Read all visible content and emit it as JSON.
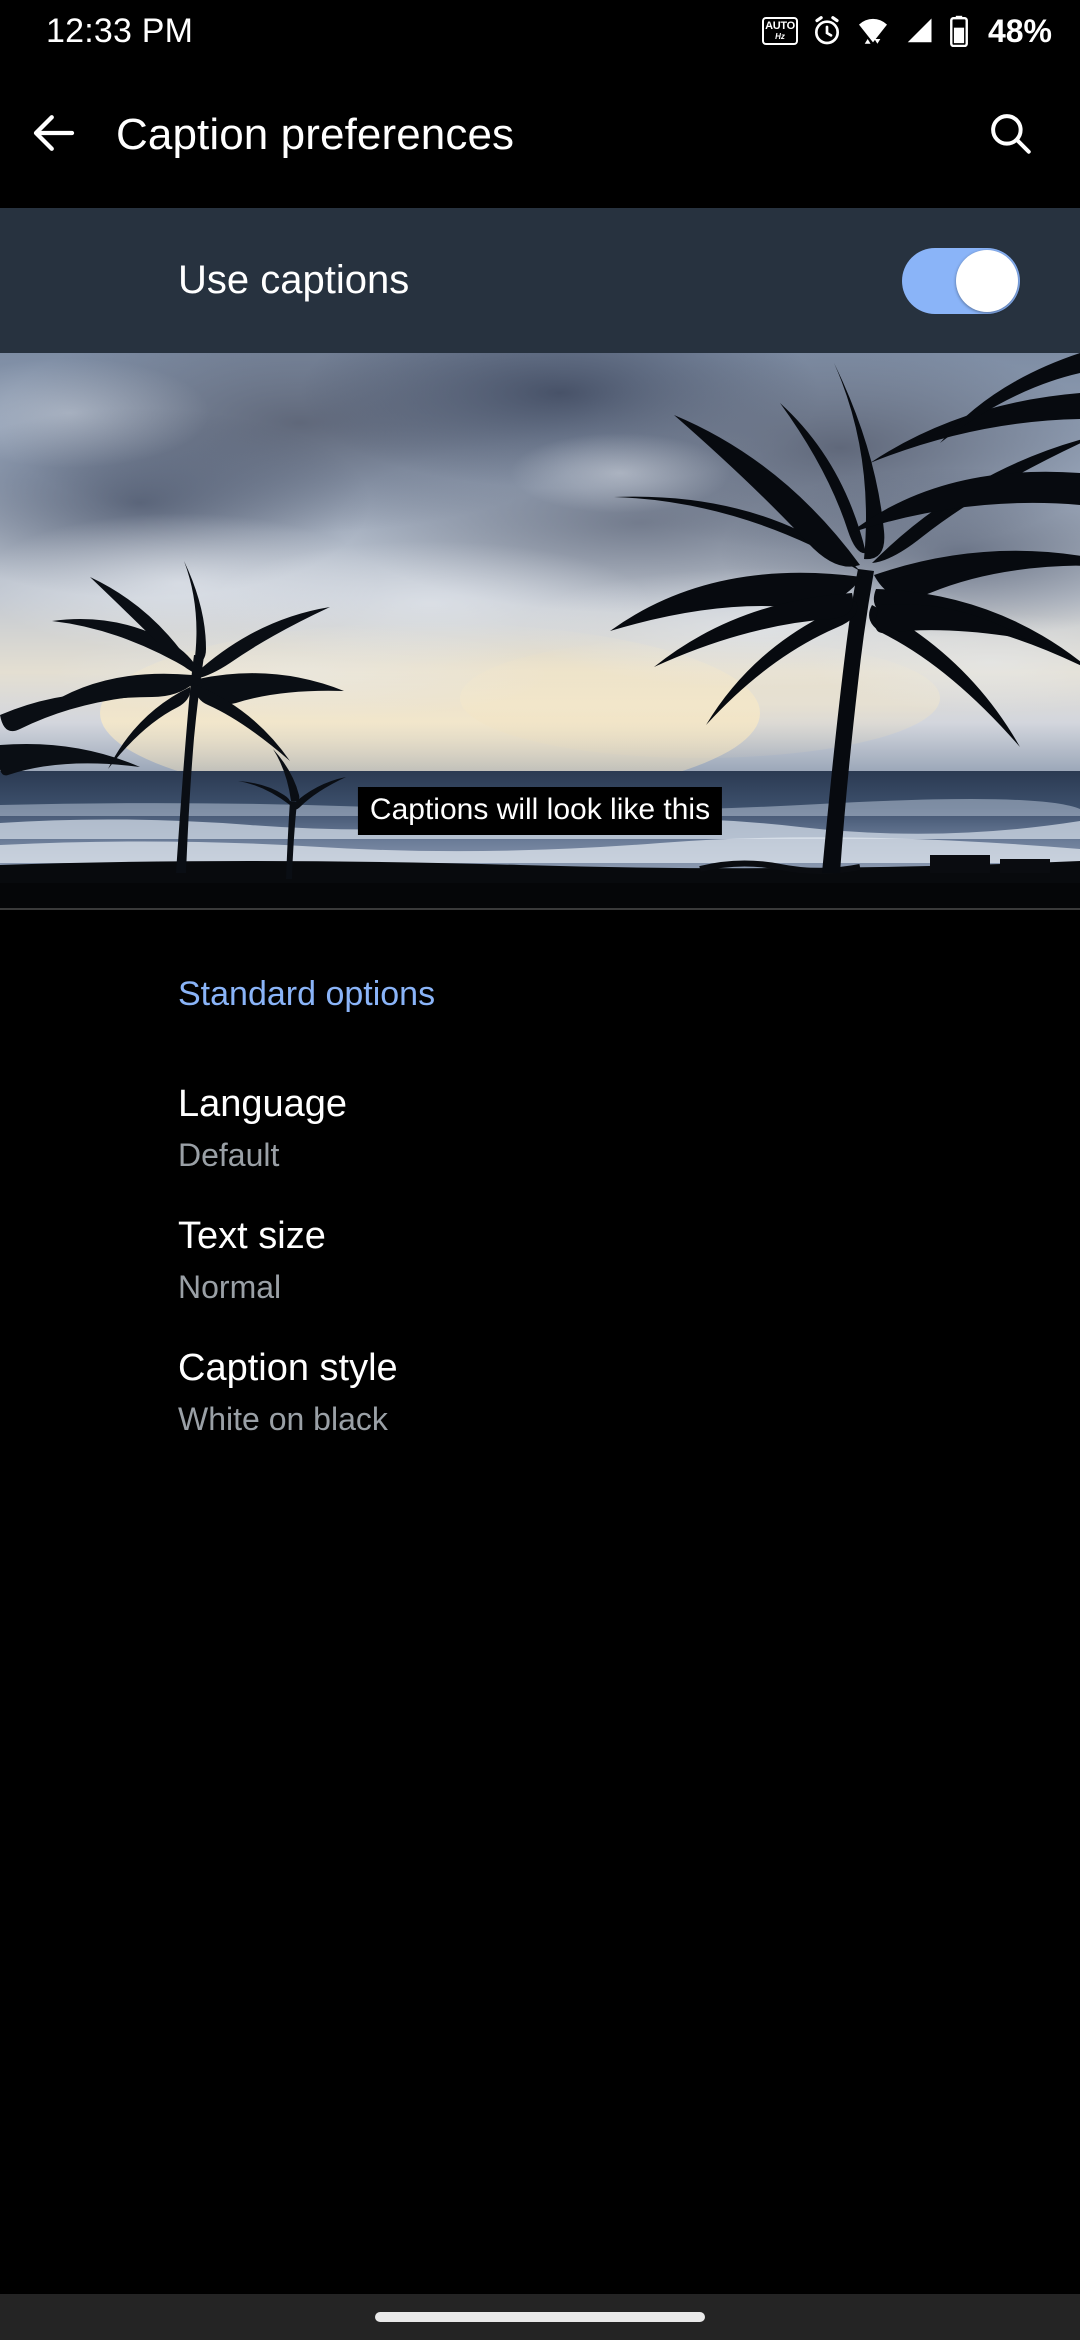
{
  "status_bar": {
    "clock": "12:33 PM",
    "battery_percent": "48%",
    "icons": [
      {
        "name": "auto-refresh-rate-icon",
        "line1": "AUTO",
        "line2": "Hz"
      },
      {
        "name": "alarm-icon"
      },
      {
        "name": "wifi-icon"
      },
      {
        "name": "cellular-signal-icon"
      },
      {
        "name": "battery-icon"
      }
    ]
  },
  "app_bar": {
    "back_icon": "arrow-back-icon",
    "title": "Caption preferences",
    "search_icon": "search-icon"
  },
  "use_captions": {
    "label": "Use captions",
    "state": "on",
    "track_color": "#8ab4f8",
    "thumb_color": "#ffffff",
    "row_background": "#27323f"
  },
  "preview": {
    "caption_text": "Captions will look like this",
    "caption_background": "#000000",
    "caption_text_color": "#ffffff",
    "scene_description": "beach sunset with palm tree silhouettes"
  },
  "standard_options": {
    "header": "Standard options",
    "header_color": "#8ab4f8",
    "items": [
      {
        "title": "Language",
        "summary": "Default"
      },
      {
        "title": "Text size",
        "summary": "Normal"
      },
      {
        "title": "Caption style",
        "summary": "White on black"
      }
    ]
  },
  "nav_bar": {
    "handle": "gesture-home-handle"
  }
}
